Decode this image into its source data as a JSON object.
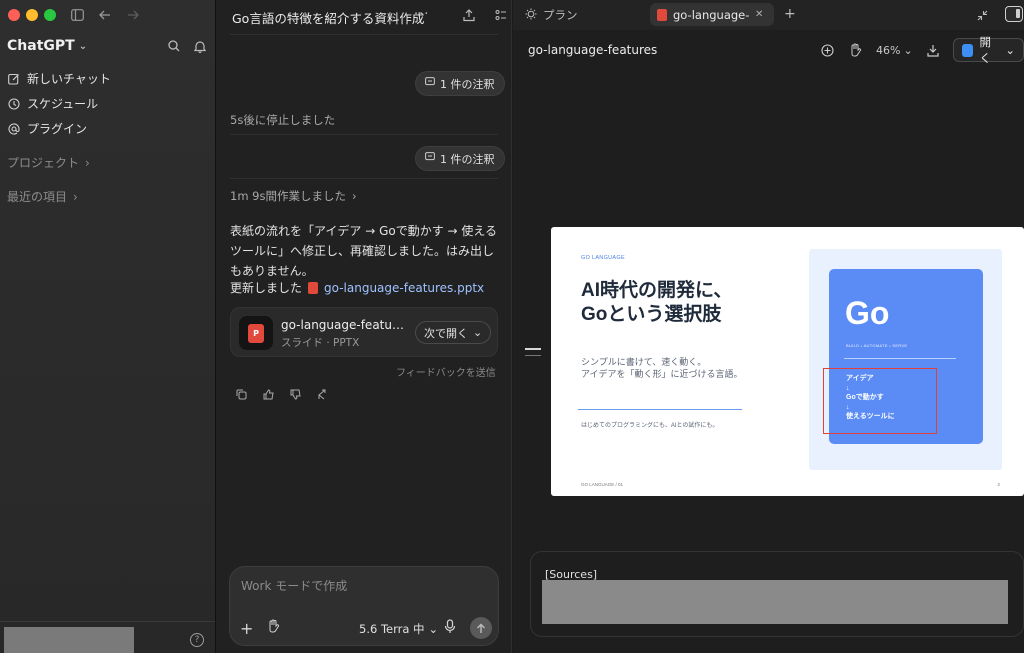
{
  "sidebar": {
    "app_name": "ChatGPT",
    "menu": [
      {
        "label": "新しいチャット",
        "icon": "edit-icon"
      },
      {
        "label": "スケジュール",
        "icon": "clock-icon"
      },
      {
        "label": "プラグイン",
        "icon": "at-icon"
      }
    ],
    "projects_label": "プロジェクト",
    "recent_label": "最近の項目",
    "help_glyph": "?"
  },
  "chat": {
    "title": "Go言語の特徴を紹介する資料作成",
    "more_glyph": "···",
    "annotation_pill_1": "1 件の注釈",
    "stopped_text": "5s後に停止しました",
    "annotation_pill_2": "1 件の注釈",
    "worked_text": "1m 9s間作業しました",
    "message": "表紙の流れを「アイデア → Goで動かす → 使えるツールに」へ修正し、再確認しました。はみ出しもありません。",
    "updated_prefix": "更新しました",
    "updated_link": "go-language-features.pptx",
    "file": {
      "name": "go-language-features.pptx",
      "type": "スライド · PPTX",
      "icon_letter": "P",
      "open_button": "次で開く"
    },
    "feedback_label": "フィードバックを送信",
    "composer": {
      "placeholder": "Work モードで作成",
      "model": "5.6 Terra 中"
    }
  },
  "right_panel": {
    "tab_plan": "プラン",
    "tab_file": "go-language-features.pptx",
    "doc_title": "go-language-features",
    "zoom": "46%",
    "open_label": "開く",
    "sources_label": "[Sources]"
  },
  "slide": {
    "kicker": "GO LANGUAGE",
    "headline_1": "AI時代の開発に、",
    "headline_2": "Goという選択肢",
    "sub_1": "シンプルに書けて、速く動く。",
    "sub_2": "アイデアを「動く形」に近づける言語。",
    "small": "はじめてのプログラミングにも、AIとの試作にも。",
    "footer": "GO LANGUAGE  /  01",
    "page": "2",
    "card_title": "Go",
    "card_tags": "BUILD  •  AUTOMATE  •  SERVE",
    "flow": [
      "アイデア",
      "↓",
      "Goで動かす",
      "↓",
      "使えるツールに"
    ]
  },
  "colors": {
    "accent_blue": "#5b8cf6",
    "highlight_red": "#e0413a",
    "link": "#9ec2ff"
  }
}
